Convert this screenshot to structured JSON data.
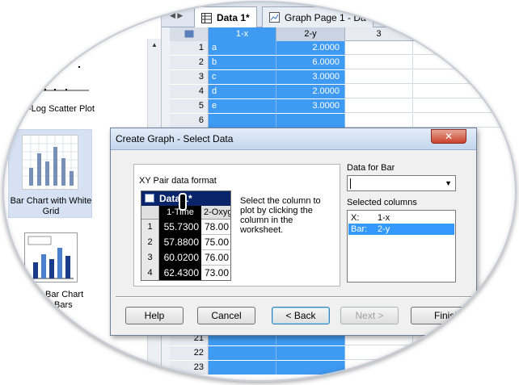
{
  "gallery": {
    "items": [
      {
        "label": "-Log Scatter Plot"
      },
      {
        "label": "Bar Chart with White Grid"
      },
      {
        "label": "d Bar Chart\nr Bars"
      }
    ]
  },
  "tabs": [
    {
      "label": "Data 1*"
    },
    {
      "label": "Graph Page 1 - Da"
    }
  ],
  "sheet": {
    "columns": [
      "1-x",
      "2-y",
      "3"
    ],
    "rows": [
      {
        "n": "1",
        "x": "a",
        "y": "2.0000"
      },
      {
        "n": "2",
        "x": "b",
        "y": "6.0000"
      },
      {
        "n": "3",
        "x": "c",
        "y": "3.0000"
      },
      {
        "n": "4",
        "x": "d",
        "y": "2.0000"
      },
      {
        "n": "5",
        "x": "e",
        "y": "3.0000"
      },
      {
        "n": "6",
        "x": "",
        "y": ""
      }
    ],
    "bottom_rows": [
      "21",
      "22",
      "23"
    ]
  },
  "dialog": {
    "title": "Create Graph - Select Data",
    "close": "✕",
    "xy_format_label": "XY Pair data format",
    "mini_sheet": {
      "title": "Data 1*",
      "col1": "1-Time",
      "col2": "2-Oxyg",
      "rows": [
        {
          "n": "1",
          "v1": "55.7300",
          "v2": "78.00"
        },
        {
          "n": "2",
          "v1": "57.8800",
          "v2": "75.00"
        },
        {
          "n": "3",
          "v1": "60.0200",
          "v2": "76.00"
        },
        {
          "n": "4",
          "v1": "62.4300",
          "v2": "73.00"
        }
      ]
    },
    "instructions": "Select the column to plot by clicking the column in the worksheet.",
    "data_for_label": "Data for Bar",
    "data_for_value": "",
    "selected_label": "Selected columns",
    "selected": [
      {
        "key": "X:",
        "val": "1-x"
      },
      {
        "key": "Bar:",
        "val": "2-y"
      }
    ],
    "buttons": {
      "help": "Help",
      "cancel": "Cancel",
      "back": "< Back",
      "next": "Next >",
      "finish": "Finish"
    }
  }
}
